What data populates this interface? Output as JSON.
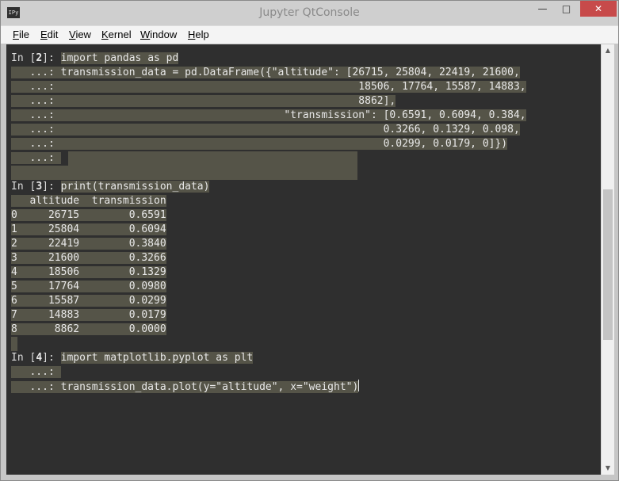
{
  "window": {
    "title": "Jupyter QtConsole",
    "icon_label": "IPy"
  },
  "menu": {
    "file": {
      "accel": "F",
      "rest": "ile"
    },
    "edit": {
      "accel": "E",
      "rest": "dit"
    },
    "view": {
      "accel": "V",
      "rest": "iew"
    },
    "kernel": {
      "accel": "K",
      "rest": "ernel"
    },
    "window": {
      "accel": "W",
      "rest": "indow"
    },
    "help": {
      "accel": "H",
      "rest": "elp"
    }
  },
  "cells": {
    "c2": {
      "pre": "In [",
      "num": "2",
      "post": "]: ",
      "lines": [
        "import pandas as pd",
        "   ...: transmission_data = pd.DataFrame({\"altitude\": [26715, 25804, 22419, 21600,",
        "   ...:                                                 18506, 17764, 15587, 14883,",
        "   ...:                                                 8862],",
        "   ...:                                     \"transmission\": [0.6591, 0.6094, 0.384,",
        "   ...:                                                     0.3266, 0.1329, 0.098,",
        "   ...:                                                     0.0299, 0.0179, 0]})",
        "   ...: "
      ]
    },
    "c3": {
      "pre": "In [",
      "num": "3",
      "post": "]: ",
      "code": "print(transmission_data)",
      "output": [
        "   altitude  transmission",
        "0     26715        0.6591",
        "1     25804        0.6094",
        "2     22419        0.3840",
        "3     21600        0.3266",
        "4     18506        0.1329",
        "5     17764        0.0980",
        "6     15587        0.0299",
        "7     14883        0.0179",
        "8      8862        0.0000"
      ]
    },
    "c4": {
      "pre": "In [",
      "num": "4",
      "post": "]: ",
      "lines": [
        "import matplotlib.pyplot as plt",
        "   ...: ",
        "   ...: transmission_data.plot(y=\"altitude\", x=\"weight\")"
      ]
    }
  },
  "icons": {
    "minimize": "—",
    "maximize": "□",
    "close": "✕",
    "scroll_up": "▲",
    "scroll_down": "▼"
  }
}
